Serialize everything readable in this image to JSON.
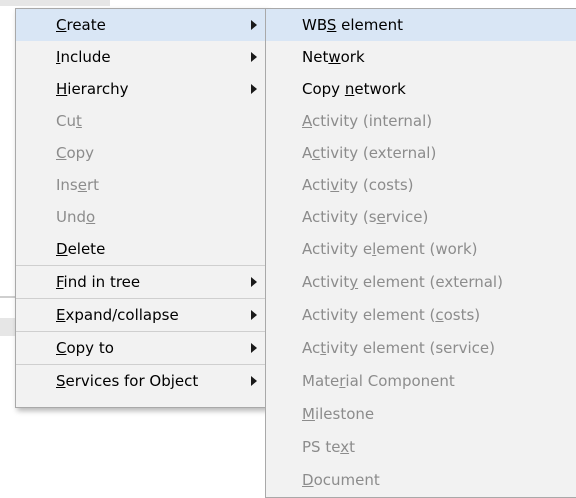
{
  "menu": {
    "items": [
      {
        "pre": "",
        "mn": "C",
        "post": "reate",
        "submenu": true,
        "enabled": true
      },
      {
        "pre": "",
        "mn": "I",
        "post": "nclude",
        "submenu": true,
        "enabled": true
      },
      {
        "pre": "",
        "mn": "H",
        "post": "ierarchy",
        "submenu": true,
        "enabled": true
      },
      {
        "pre": "Cu",
        "mn": "t",
        "post": "",
        "submenu": false,
        "enabled": false
      },
      {
        "pre": "",
        "mn": "C",
        "post": "opy",
        "submenu": false,
        "enabled": false
      },
      {
        "pre": "Ins",
        "mn": "e",
        "post": "rt",
        "submenu": false,
        "enabled": false
      },
      {
        "pre": "Und",
        "mn": "o",
        "post": "",
        "submenu": false,
        "enabled": false
      },
      {
        "pre": "",
        "mn": "D",
        "post": "elete",
        "submenu": false,
        "enabled": true
      },
      {
        "pre": "",
        "mn": "F",
        "post": "ind in tree",
        "submenu": true,
        "enabled": true
      },
      {
        "pre": "",
        "mn": "E",
        "post": "xpand/collapse",
        "submenu": true,
        "enabled": true
      },
      {
        "pre": "",
        "mn": "C",
        "post": "opy to",
        "submenu": true,
        "enabled": true
      },
      {
        "pre": "",
        "mn": "S",
        "post": "ervices for Object",
        "submenu": true,
        "enabled": true
      }
    ]
  },
  "submenu": {
    "items": [
      {
        "pre": "WB",
        "mn": "S",
        "post": " element",
        "enabled": true
      },
      {
        "pre": "Net",
        "mn": "w",
        "post": "ork",
        "enabled": true
      },
      {
        "pre": "Copy ",
        "mn": "n",
        "post": "etwork",
        "enabled": true
      },
      {
        "pre": "",
        "mn": "A",
        "post": "ctivity (internal)",
        "enabled": false
      },
      {
        "pre": "A",
        "mn": "c",
        "post": "tivity (external)",
        "enabled": false
      },
      {
        "pre": "Acti",
        "mn": "v",
        "post": "ity (costs)",
        "enabled": false
      },
      {
        "pre": "Activity (s",
        "mn": "e",
        "post": "rvice)",
        "enabled": false
      },
      {
        "pre": "Activity e",
        "mn": "l",
        "post": "ement (work)",
        "enabled": false
      },
      {
        "pre": "Activit",
        "mn": "y",
        "post": " element (external)",
        "enabled": false
      },
      {
        "pre": "Activity element (",
        "mn": "c",
        "post": "osts)",
        "enabled": false
      },
      {
        "pre": "Ac",
        "mn": "t",
        "post": "ivity element (service)",
        "enabled": false
      },
      {
        "pre": "Mate",
        "mn": "r",
        "post": "ial Component",
        "enabled": false
      },
      {
        "pre": "",
        "mn": "M",
        "post": "ilestone",
        "enabled": false
      },
      {
        "pre": "PS te",
        "mn": "x",
        "post": "t",
        "enabled": false
      },
      {
        "pre": "",
        "mn": "D",
        "post": "ocument",
        "enabled": false
      }
    ]
  },
  "colors": {
    "menu_bg": "#f2f2f2",
    "highlight": "#d9e6f5",
    "enabled_text": "#000000",
    "disabled_text": "#8c8c8c"
  },
  "icons": {
    "submenu_arrow": "triangle-right",
    "scroll_up": "chevron-up"
  }
}
